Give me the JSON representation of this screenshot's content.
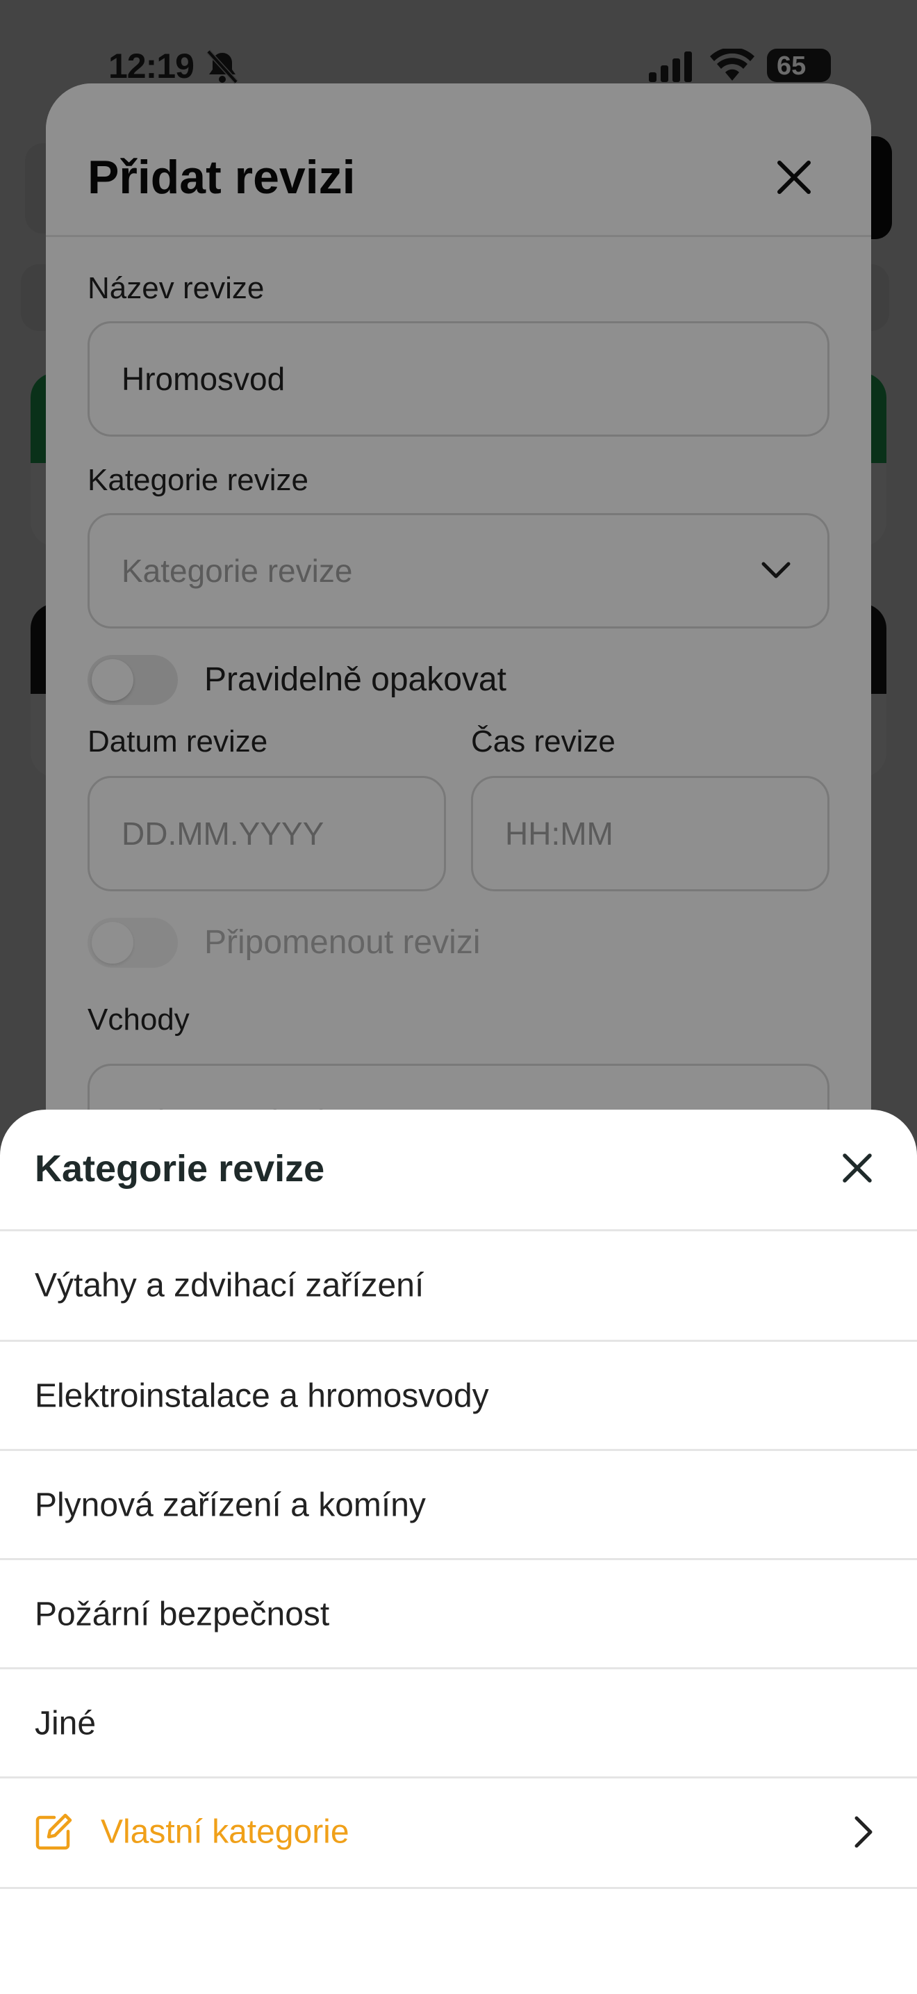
{
  "status_bar": {
    "time": "12:19",
    "battery": "65",
    "icons": [
      "bell-muted-icon",
      "signal-icon",
      "wifi-icon",
      "battery-icon"
    ]
  },
  "modal": {
    "title": "Přidat revizi",
    "close_icon": "close-icon",
    "name_label": "Název revize",
    "name_value": "Hromosvod",
    "category_label": "Kategorie revize",
    "category_placeholder": "Kategorie revize",
    "repeat_label": "Pravidelně opakovat",
    "repeat_on": false,
    "date_label": "Datum revize",
    "date_placeholder": "DD.MM.YYYY",
    "time_label": "Čas revize",
    "time_placeholder": "HH:MM",
    "remind_label": "Připomenout revizi",
    "remind_on": false,
    "entrances_label": "Vchody",
    "entrances_placeholder": "Vyberte vchod"
  },
  "sheet": {
    "title": "Kategorie revize",
    "close_icon": "close-icon",
    "items": [
      {
        "label": "Výtahy a zdvihací zařízení"
      },
      {
        "label": "Elektroinstalace a hromosvody"
      },
      {
        "label": "Plynová zařízení a komíny"
      },
      {
        "label": "Požární bezpečnost"
      },
      {
        "label": "Jiné"
      }
    ],
    "custom": {
      "label": "Vlastní kategorie",
      "icon": "edit-icon",
      "chevron": "chevron-right-icon",
      "color": "#f0a019"
    }
  },
  "colors": {
    "accent": "#f0a019",
    "background_green": "#27b15a",
    "background_dark": "#111111"
  }
}
